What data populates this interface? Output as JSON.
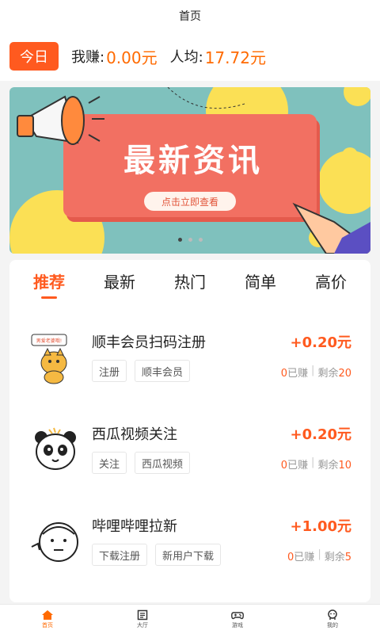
{
  "header": {
    "title": "首页"
  },
  "earnings": {
    "today_label": "今日",
    "my_earn_label": "我赚:",
    "my_earn_value": "0.00元",
    "avg_label": "人均:",
    "avg_value": "17.72元"
  },
  "banner": {
    "title": "最新资讯",
    "cta": "点击立即查看",
    "slides": 3,
    "active_slide": 1
  },
  "tabs": [
    "推荐",
    "最新",
    "热门",
    "简单",
    "高价"
  ],
  "active_tab": 0,
  "tasks": [
    {
      "title": "顺丰会员扫码注册",
      "reward": "+0.20元",
      "tags": [
        "注册",
        "顺丰会员"
      ],
      "earned": "0",
      "earned_label": "已赚",
      "remaining_label": "剩余",
      "remaining": "20",
      "avatar_icon": "cat-avatar-icon",
      "avatar_caption": "男爱老婆哦!"
    },
    {
      "title": "西瓜视频关注",
      "reward": "+0.20元",
      "tags": [
        "关注",
        "西瓜视频"
      ],
      "earned": "0",
      "earned_label": "已赚",
      "remaining_label": "剩余",
      "remaining": "10",
      "avatar_icon": "panda-avatar-icon"
    },
    {
      "title": "哔哩哔哩拉新",
      "reward": "+1.00元",
      "tags": [
        "下载注册",
        "新用户下载"
      ],
      "earned": "0",
      "earned_label": "已赚",
      "remaining_label": "剩余",
      "remaining": "5",
      "avatar_icon": "face-avatar-icon"
    }
  ],
  "bottom_nav": [
    {
      "label": "首页",
      "icon": "home-icon",
      "active": true
    },
    {
      "label": "大厅",
      "icon": "list-icon",
      "active": false
    },
    {
      "label": "游戏",
      "icon": "gamepad-icon",
      "active": false
    },
    {
      "label": "我的",
      "icon": "profile-icon",
      "active": false
    }
  ],
  "colors": {
    "accent": "#ff5a1f",
    "banner_bg": "#7fc1bd",
    "banner_card": "#f27062"
  }
}
